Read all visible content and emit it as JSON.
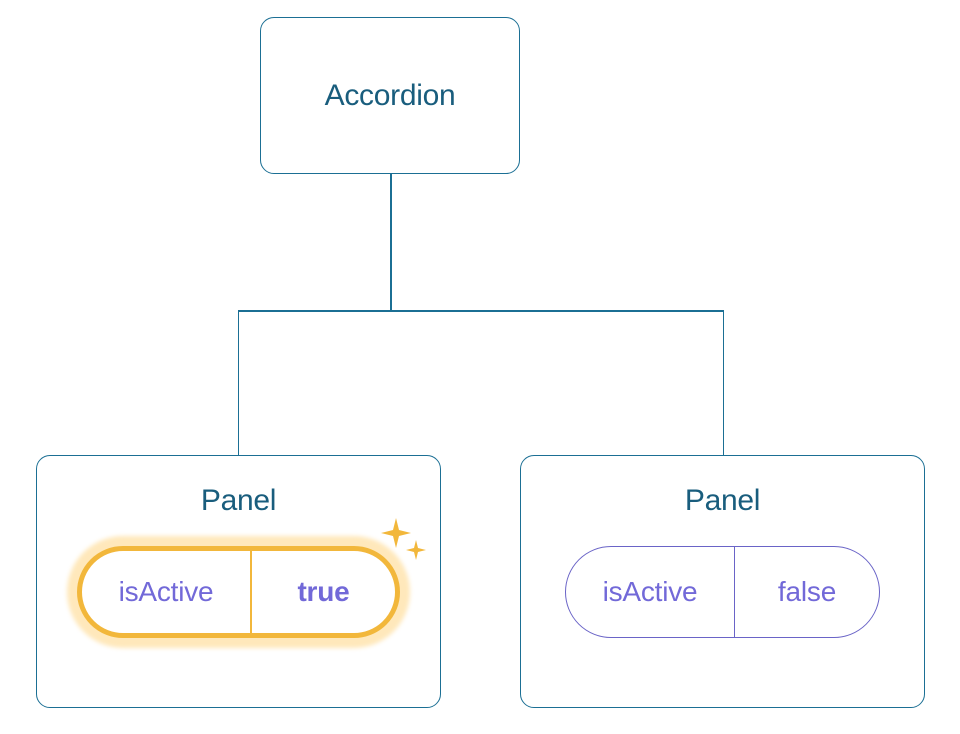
{
  "root": {
    "label": "Accordion"
  },
  "panels": [
    {
      "label": "Panel",
      "prop": "isActive",
      "value": "true",
      "highlighted": true
    },
    {
      "label": "Panel",
      "prop": "isActive",
      "value": "false",
      "highlighted": false
    }
  ]
}
